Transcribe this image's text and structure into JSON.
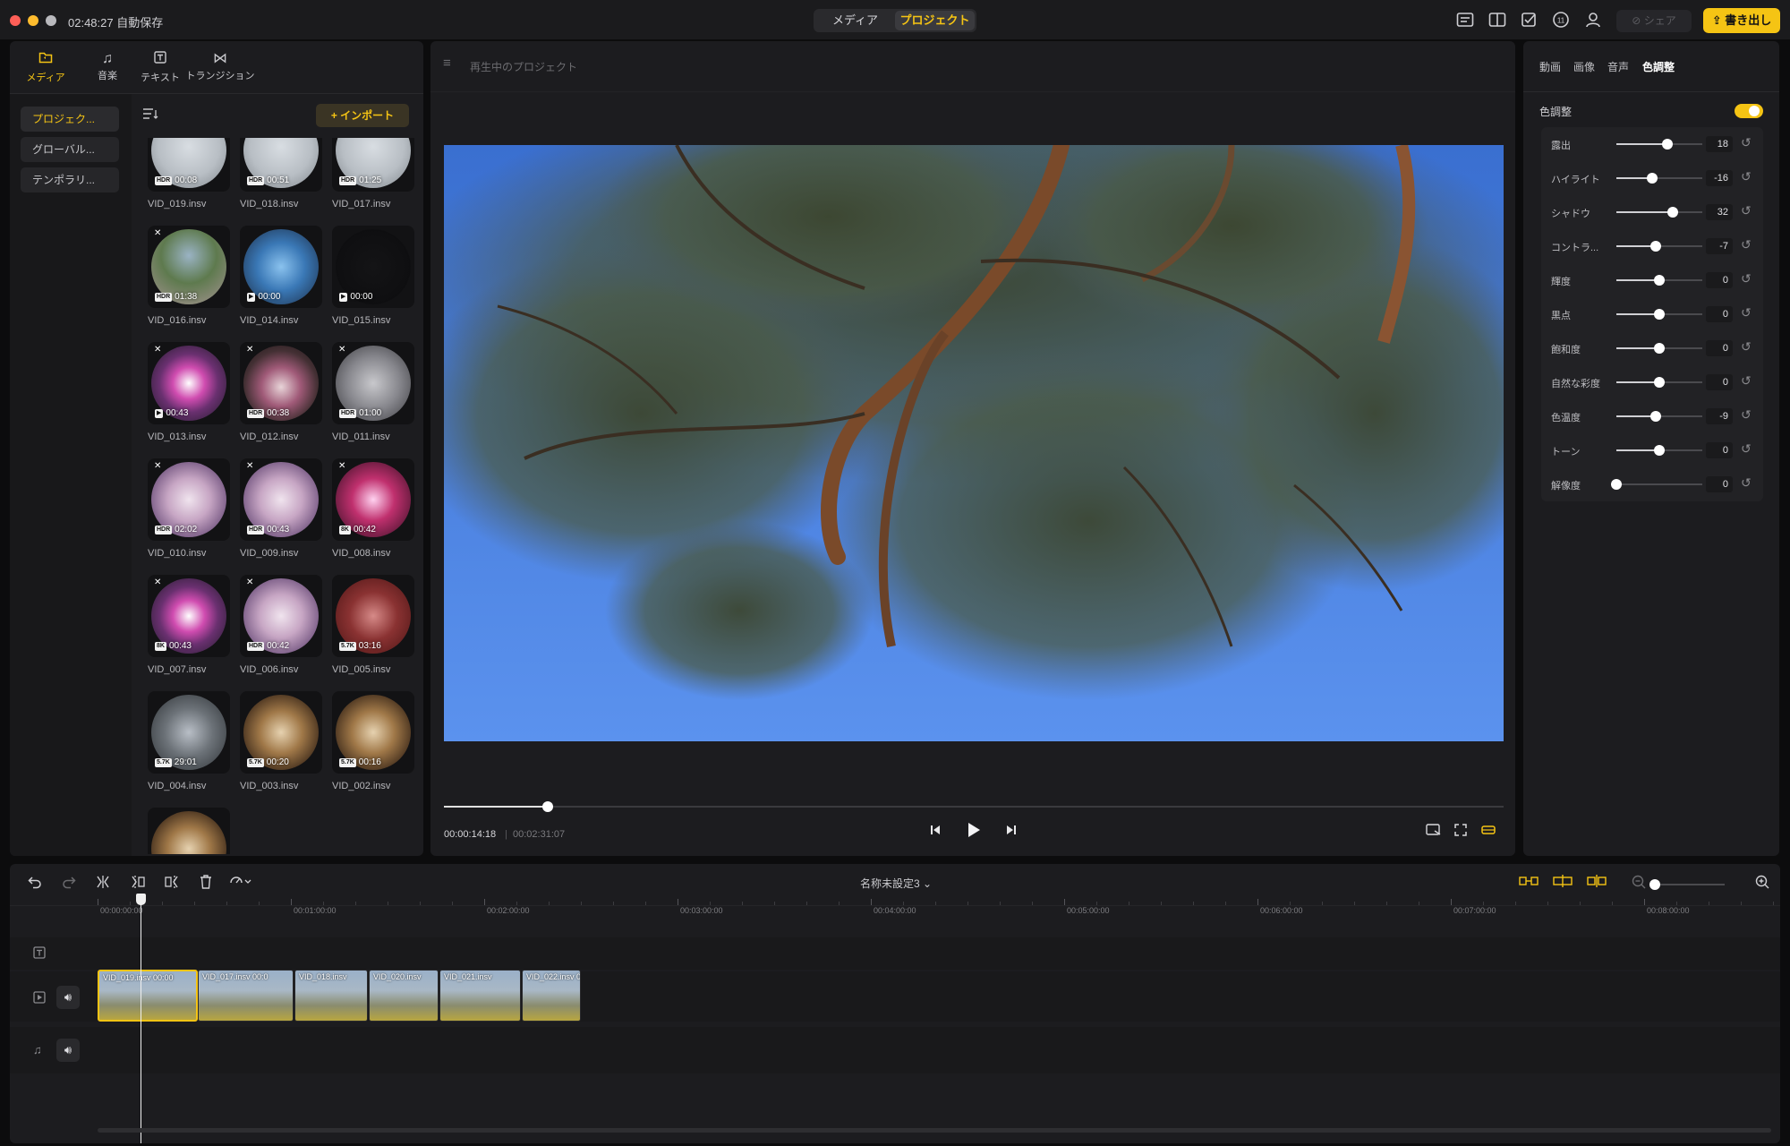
{
  "titlebar": {
    "autosave": "02:48:27 自動保存",
    "modes": [
      "メディア",
      "プロジェクト"
    ],
    "active_mode": 1,
    "share": "シェア",
    "export": "書き出し"
  },
  "left_panel": {
    "tabs": [
      {
        "icon": "folder-icon",
        "label": "メディア"
      },
      {
        "icon": "music-icon",
        "label": "音楽"
      },
      {
        "icon": "text-icon",
        "label": "テキスト"
      },
      {
        "icon": "transition-icon",
        "label": "トランジション"
      }
    ],
    "sidebar": [
      "プロジェク...",
      "グローバル...",
      "テンポラリ..."
    ],
    "import": "+ インポート",
    "media": [
      {
        "name": "VID_019.insv",
        "badge": "HDR",
        "duration": "00:08",
        "x": false,
        "palette": "snow"
      },
      {
        "name": "VID_018.insv",
        "badge": "HDR",
        "duration": "00:51",
        "x": false,
        "palette": "snow"
      },
      {
        "name": "VID_017.insv",
        "badge": "HDR",
        "duration": "01:25",
        "x": false,
        "palette": "snow"
      },
      {
        "name": "VID_016.insv",
        "badge": "HDR",
        "duration": "01:38",
        "x": true,
        "palette": "forest"
      },
      {
        "name": "VID_014.insv",
        "badge": "CAM",
        "duration": "00:00",
        "x": false,
        "palette": "bluehall"
      },
      {
        "name": "VID_015.insv",
        "badge": "CAM",
        "duration": "00:00",
        "x": false,
        "palette": "dark"
      },
      {
        "name": "VID_013.insv",
        "badge": "CAM",
        "duration": "00:43",
        "x": true,
        "palette": "neon"
      },
      {
        "name": "VID_012.insv",
        "badge": "HDR",
        "duration": "00:38",
        "x": true,
        "palette": "neon2"
      },
      {
        "name": "VID_011.insv",
        "badge": "HDR",
        "duration": "01:00",
        "x": true,
        "palette": "grey"
      },
      {
        "name": "VID_010.insv",
        "badge": "HDR",
        "duration": "02:02",
        "x": true,
        "palette": "pinkhall"
      },
      {
        "name": "VID_009.insv",
        "badge": "HDR",
        "duration": "00:43",
        "x": true,
        "palette": "pinkhall"
      },
      {
        "name": "VID_008.insv",
        "badge": "8K",
        "duration": "00:42",
        "x": true,
        "palette": "neon3"
      },
      {
        "name": "VID_007.insv",
        "badge": "8K",
        "duration": "00:43",
        "x": true,
        "palette": "neon"
      },
      {
        "name": "VID_006.insv",
        "badge": "HDR",
        "duration": "00:42",
        "x": true,
        "palette": "pinkhall"
      },
      {
        "name": "VID_005.insv",
        "badge": "5.7K",
        "duration": "03:16",
        "x": false,
        "palette": "red"
      },
      {
        "name": "VID_004.insv",
        "badge": "5.7K",
        "duration": "29:01",
        "x": false,
        "palette": "greyhall"
      },
      {
        "name": "VID_003.insv",
        "badge": "5.7K",
        "duration": "00:20",
        "x": false,
        "palette": "warm"
      },
      {
        "name": "VID_002.insv",
        "badge": "5.7K",
        "duration": "00:16",
        "x": false,
        "palette": "warm"
      },
      {
        "name": "",
        "badge": "",
        "duration": "",
        "x": false,
        "palette": "warm"
      }
    ]
  },
  "preview": {
    "title": "再生中のプロジェクト",
    "current_time": "00:00:14:18",
    "separator": "|",
    "total_time": "00:02:31:07",
    "progress": 0.098
  },
  "right_panel": {
    "tabs": [
      "動画",
      "画像",
      "音声",
      "色調整"
    ],
    "active_tab": 3,
    "section_title": "色調整",
    "toggle_on": true,
    "adjustments": [
      {
        "label": "露出",
        "value": "18",
        "pos": 0.59
      },
      {
        "label": "ハイライト",
        "value": "-16",
        "pos": 0.42
      },
      {
        "label": "シャドウ",
        "value": "32",
        "pos": 0.66
      },
      {
        "label": "コントラ...",
        "value": "-7",
        "pos": 0.46
      },
      {
        "label": "輝度",
        "value": "0",
        "pos": 0.5
      },
      {
        "label": "黒点",
        "value": "0",
        "pos": 0.5
      },
      {
        "label": "飽和度",
        "value": "0",
        "pos": 0.5
      },
      {
        "label": "自然な彩度",
        "value": "0",
        "pos": 0.5
      },
      {
        "label": "色温度",
        "value": "-9",
        "pos": 0.46
      },
      {
        "label": "トーン",
        "value": "0",
        "pos": 0.5
      },
      {
        "label": "解像度",
        "value": "0",
        "pos": 0.0
      }
    ]
  },
  "timeline": {
    "project_name": "名称未設定3 ⌄",
    "zoom": 0.0,
    "ruler": [
      "00:00:00:00",
      "00:01:00:00",
      "00:02:00:00",
      "00:03:00:00",
      "00:04:00:00",
      "00:05:00:00",
      "00:06:00:00",
      "00:07:00:00",
      "00:08:00:00"
    ],
    "clips": [
      {
        "label": "VID_019.insv  00:00",
        "selected": true
      },
      {
        "label": "VID_017.insv  00:0",
        "selected": false
      },
      {
        "label": "VID_018.insv",
        "selected": false
      },
      {
        "label": "VID_020.insv",
        "selected": false
      },
      {
        "label": "VID_021.insv",
        "selected": false
      },
      {
        "label": "VID_022.insv  00",
        "selected": false
      }
    ],
    "playhead_time": "00:00:00:00"
  }
}
